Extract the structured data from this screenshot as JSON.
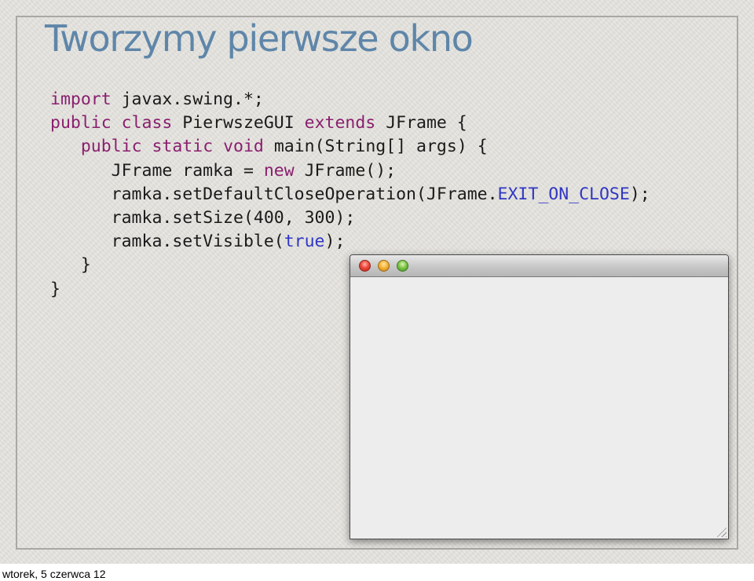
{
  "slide": {
    "title": "Tworzymy pierwsze okno",
    "code_lines": [
      [
        {
          "t": "import",
          "k": "kw"
        },
        {
          "t": " javax.swing.*;",
          "k": ""
        }
      ],
      [
        {
          "t": "public",
          "k": "kw"
        },
        {
          "t": " ",
          "k": ""
        },
        {
          "t": "class",
          "k": "kw"
        },
        {
          "t": " PierwszeGUI ",
          "k": ""
        },
        {
          "t": "extends",
          "k": "kw"
        },
        {
          "t": " JFrame {",
          "k": ""
        }
      ],
      [
        {
          "t": "   ",
          "k": ""
        },
        {
          "t": "public",
          "k": "kw"
        },
        {
          "t": " ",
          "k": ""
        },
        {
          "t": "static",
          "k": "kw"
        },
        {
          "t": " ",
          "k": ""
        },
        {
          "t": "void",
          "k": "kw"
        },
        {
          "t": " main(String[] args) {",
          "k": ""
        }
      ],
      [
        {
          "t": "      JFrame ramka = ",
          "k": ""
        },
        {
          "t": "new",
          "k": "kw"
        },
        {
          "t": " JFrame();",
          "k": ""
        }
      ],
      [
        {
          "t": "      ramka.setDefaultCloseOperation(JFrame.",
          "k": ""
        },
        {
          "t": "EXIT_ON_CLOSE",
          "k": "lit"
        },
        {
          "t": ");",
          "k": ""
        }
      ],
      [
        {
          "t": "      ramka.setSize(400, 300);",
          "k": ""
        }
      ],
      [
        {
          "t": "      ramka.setVisible(",
          "k": ""
        },
        {
          "t": "true",
          "k": "lit"
        },
        {
          "t": ");",
          "k": ""
        }
      ],
      [
        {
          "t": "   }",
          "k": ""
        }
      ],
      [
        {
          "t": "}",
          "k": ""
        }
      ]
    ]
  },
  "footer": {
    "date": "wtorek, 5 czerwca 12"
  },
  "colors": {
    "title": "#5f86a9",
    "keyword": "#8a1f6e",
    "literal": "#3136c4",
    "code_text": "#1a1a1a",
    "slide_background": "#e3e2dd"
  },
  "window": {
    "buttons": [
      "close-button",
      "minimize-button",
      "zoom-button"
    ]
  }
}
